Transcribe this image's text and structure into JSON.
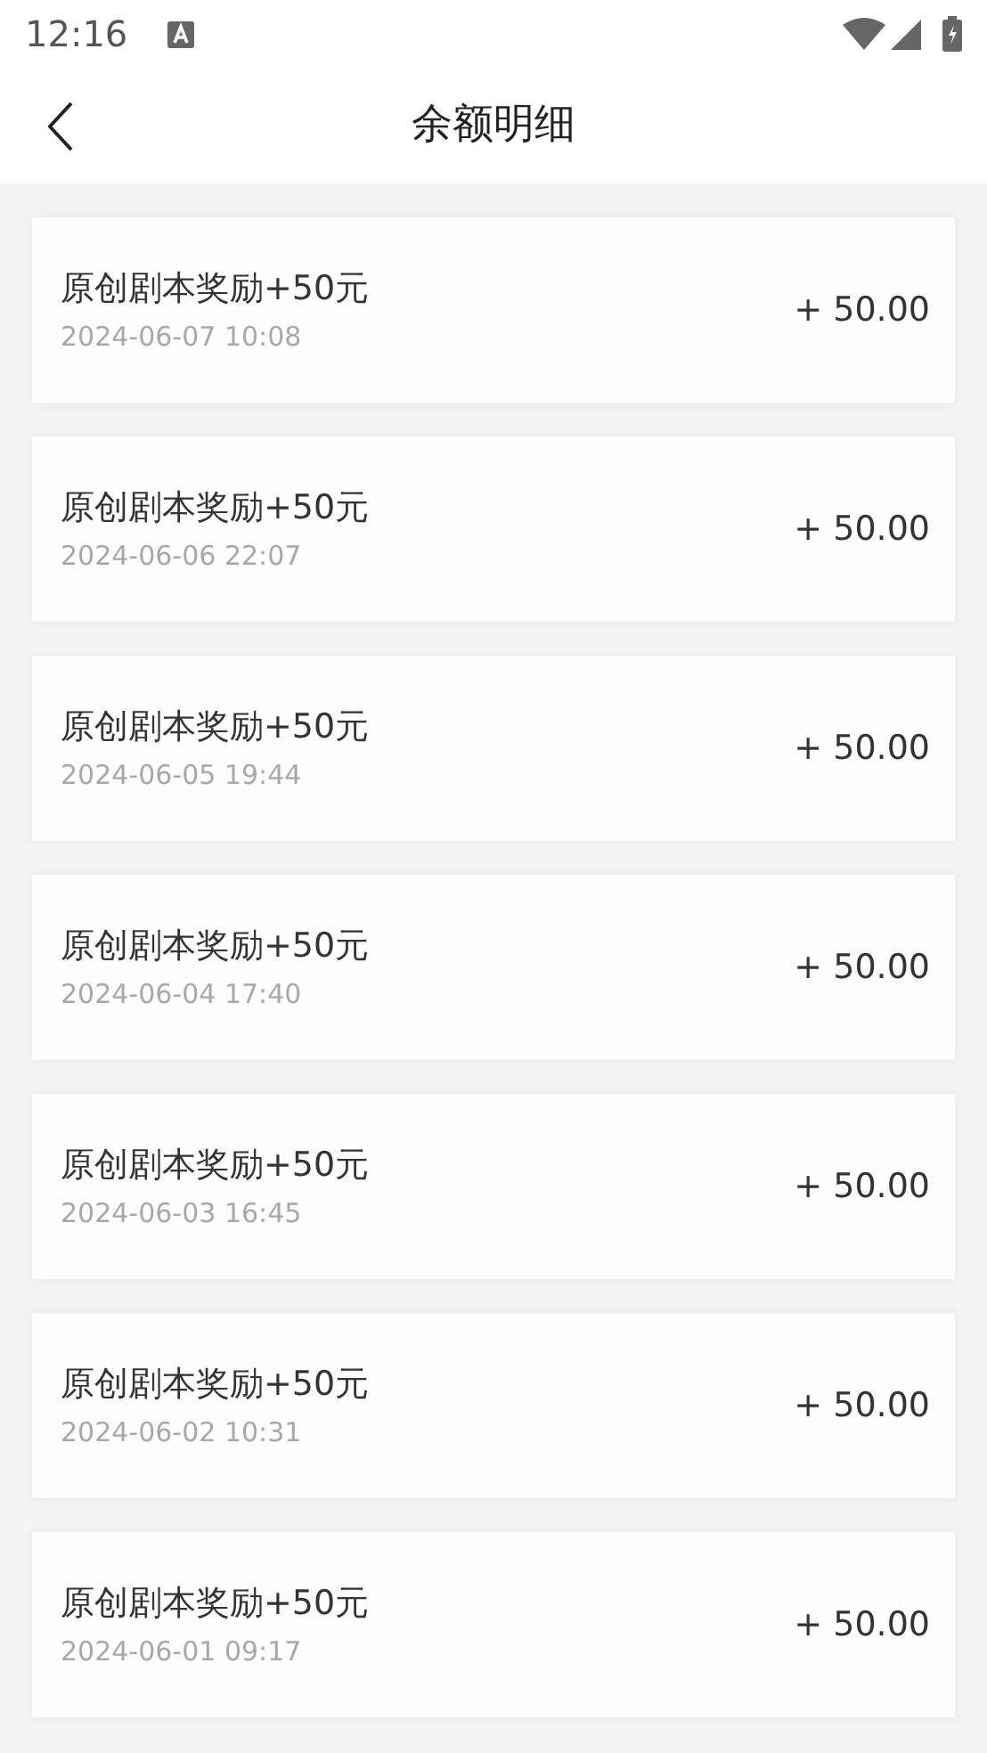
{
  "status_bar": {
    "time": "12:16"
  },
  "header": {
    "title": "余额明细"
  },
  "records": [
    {
      "title": "原创剧本奖励+50元",
      "time": "2024-06-07 10:08",
      "amount": "+ 50.00"
    },
    {
      "title": "原创剧本奖励+50元",
      "time": "2024-06-06 22:07",
      "amount": "+ 50.00"
    },
    {
      "title": "原创剧本奖励+50元",
      "time": "2024-06-05 19:44",
      "amount": "+ 50.00"
    },
    {
      "title": "原创剧本奖励+50元",
      "time": "2024-06-04 17:40",
      "amount": "+ 50.00"
    },
    {
      "title": "原创剧本奖励+50元",
      "time": "2024-06-03 16:45",
      "amount": "+ 50.00"
    },
    {
      "title": "原创剧本奖励+50元",
      "time": "2024-06-02 10:31",
      "amount": "+ 50.00"
    },
    {
      "title": "原创剧本奖励+50元",
      "time": "2024-06-01 09:17",
      "amount": "+ 50.00"
    }
  ]
}
